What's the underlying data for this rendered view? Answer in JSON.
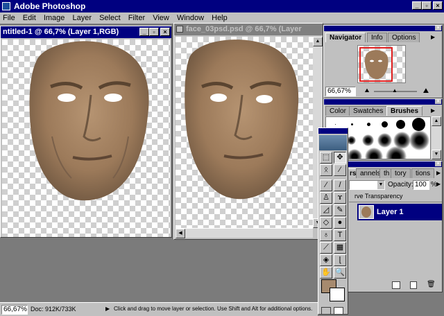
{
  "app": {
    "title": "Adobe Photoshop"
  },
  "menu": [
    "File",
    "Edit",
    "Image",
    "Layer",
    "Select",
    "Filter",
    "View",
    "Window",
    "Help"
  ],
  "doc1": {
    "title": "ntitled-1 @ 66,7% (Layer 1,RGB)"
  },
  "doc2": {
    "title": "face_03psd.psd @ 66,7% (Layer"
  },
  "navigator": {
    "tabs": [
      "Navigator",
      "Info",
      "Options"
    ],
    "zoom": "66,67%"
  },
  "brushes": {
    "tabs": [
      "Color",
      "Swatches",
      "Brushes"
    ]
  },
  "layers": {
    "tabs": [
      "rs",
      "annels",
      "th",
      "tory",
      "tions"
    ],
    "opacity_label": "Opacity:",
    "opacity_value": "100",
    "opacity_unit": "%",
    "preserve_label": "rve Transparency",
    "layer_name": "Layer 1"
  },
  "toolbox": {
    "tools": [
      {
        "name": "marquee-tool",
        "glyph": "⬚"
      },
      {
        "name": "move-tool",
        "glyph": "✥"
      },
      {
        "name": "lasso-tool",
        "glyph": "ᛟ"
      },
      {
        "name": "magic-wand-tool",
        "glyph": "⁄"
      },
      {
        "name": "airbrush-tool",
        "glyph": "⁄"
      },
      {
        "name": "paintbrush-tool",
        "glyph": "/"
      },
      {
        "name": "rubber-stamp-tool",
        "glyph": "♙"
      },
      {
        "name": "history-brush-tool",
        "glyph": "ɤ"
      },
      {
        "name": "eraser-tool",
        "glyph": "◿"
      },
      {
        "name": "pencil-tool",
        "glyph": "✎"
      },
      {
        "name": "blur-tool",
        "glyph": "◇"
      },
      {
        "name": "dodge-tool",
        "glyph": "●"
      },
      {
        "name": "pen-tool",
        "glyph": "♁"
      },
      {
        "name": "type-tool",
        "glyph": "T"
      },
      {
        "name": "measure-tool",
        "glyph": "⟋"
      },
      {
        "name": "gradient-tool",
        "glyph": "▦"
      },
      {
        "name": "paint-bucket-tool",
        "glyph": "◈"
      },
      {
        "name": "eyedropper-tool",
        "glyph": "ɭ"
      },
      {
        "name": "hand-tool",
        "glyph": "✋"
      },
      {
        "name": "zoom-tool",
        "glyph": "🔍"
      }
    ],
    "foreground_color": "#a68a6e",
    "background_color": "#ffffff"
  },
  "statusbar": {
    "zoom": "66,67%",
    "doc": "Doc: 912K/733K",
    "hint": "Click and drag to move layer or selection.  Use Shift and Alt for additional options."
  },
  "colors": {
    "desktop": "#7b7b7b",
    "title_active": "#000080",
    "title_inactive": "#808080",
    "selection": "#000080"
  }
}
